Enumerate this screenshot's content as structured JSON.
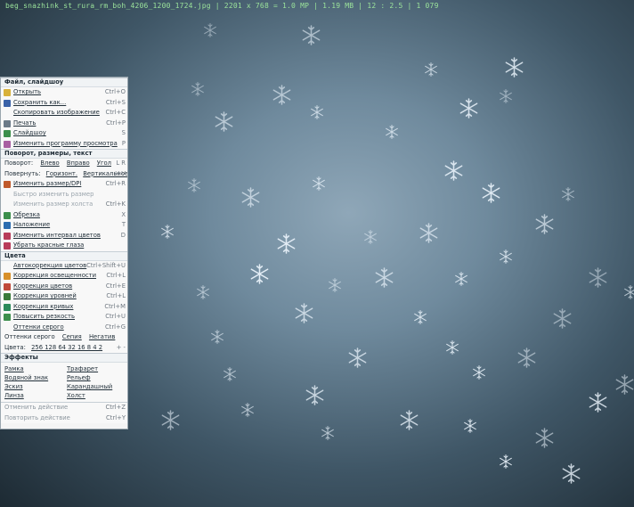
{
  "status": {
    "text": "beg_snazhink_st_rura_rm_boh_4206_1200_1724.jpg  |  2201 x 768 = 1.0 MP  |  1.19 MB  |  12 : 2.5  |  1 079"
  },
  "colors": {
    "panel_bg": "#f4f4f4",
    "accent": "#2b6cb0",
    "bg_center": "#8fa7b8",
    "bg_edge": "#1d2a33"
  },
  "menu": {
    "file": {
      "title": "Файл, слайдшоу",
      "items": [
        {
          "label": "Открыть",
          "shortcut": "Ctrl+O",
          "icon": "open-folder-icon",
          "icon_color": "#d8b13a"
        },
        {
          "label": "Сохранить как...",
          "shortcut": "Ctrl+S",
          "icon": "save-icon",
          "icon_color": "#3a62a8"
        },
        {
          "label": "Скопировать изображение",
          "shortcut": "Ctrl+C",
          "icon": "",
          "icon_color": ""
        },
        {
          "label": "Печать",
          "shortcut": "Ctrl+P",
          "icon": "print-icon",
          "icon_color": "#6b7a88"
        },
        {
          "label": "Слайдшоу",
          "shortcut": "S",
          "icon": "slideshow-icon",
          "icon_color": "#3c8f4c"
        },
        {
          "label": "Изменить программу просмотра",
          "shortcut": "P",
          "icon": "edit-program-icon",
          "icon_color": "#a85fa2"
        }
      ]
    },
    "rotate": {
      "title": "Поворот, размеры, текст",
      "rotate_line": {
        "label": "Поворот:",
        "left": "Влево",
        "right": "Вправо",
        "angle": "Угол",
        "shortcut": "L R"
      },
      "mirror_line": {
        "label": "Повернуть:",
        "horizontal": "Горизонт.",
        "vertical": "Вертикальное",
        "shortcut": "H V"
      },
      "items": [
        {
          "label": "Изменить размер/DPI",
          "shortcut": "Ctrl+R",
          "icon": "resize-icon",
          "icon_color": "#c05a2b",
          "disabled": false
        },
        {
          "label": "Быстро изменить размер",
          "shortcut": "",
          "icon": "",
          "icon_color": "",
          "disabled": true
        },
        {
          "label": "Изменить размер холста",
          "shortcut": "Ctrl+K",
          "icon": "",
          "icon_color": "",
          "disabled": true
        },
        {
          "label": "Обрезка",
          "shortcut": "X",
          "icon": "crop-icon",
          "icon_color": "#3c8f4c",
          "disabled": false
        },
        {
          "label": "Наложение",
          "shortcut": "T",
          "icon": "overlay-icon",
          "icon_color": "#2b6cb0",
          "disabled": false
        },
        {
          "label": "Изменить интервал цветов",
          "shortcut": "D",
          "icon": "color-icon",
          "icon_color": "#b83c5a",
          "disabled": false
        },
        {
          "label": "Убрать красные глаза",
          "shortcut": "",
          "icon": "eye-icon",
          "icon_color": "#b83c5a",
          "disabled": false
        }
      ]
    },
    "colors": {
      "title": "Цвета",
      "items": [
        {
          "label": "Автокоррекция цветов",
          "shortcut": "Ctrl+Shift+U",
          "icon": "",
          "icon_color": ""
        },
        {
          "label": "Коррекция освещенности",
          "shortcut": "Ctrl+L",
          "icon": "light-icon",
          "icon_color": "#d8902a"
        },
        {
          "label": "Коррекция цветов",
          "shortcut": "Ctrl+E",
          "icon": "palette-icon",
          "icon_color": "#c04a3a"
        },
        {
          "label": "Коррекция уровней",
          "shortcut": "Ctrl+L",
          "icon": "levels-icon",
          "icon_color": "#3a7a3a"
        },
        {
          "label": "Коррекция кривых",
          "shortcut": "Ctrl+M",
          "icon": "curves-icon",
          "icon_color": "#2b8a5a"
        },
        {
          "label": "Повысить резкость",
          "shortcut": "Ctrl+U",
          "icon": "sharpen-icon",
          "icon_color": "#3c8f4c"
        },
        {
          "label": "Оттенки серого",
          "shortcut": "Ctrl+G",
          "icon": "",
          "icon_color": ""
        }
      ],
      "neg_line": {
        "label": "Оттенки серого",
        "a": "Сепия",
        "b": "Негатив"
      },
      "bits_line": {
        "label": "Цвета:",
        "values": "256 128 64 32 16 8 4 2",
        "tail": "+ -"
      }
    },
    "effects": {
      "title": "Эффекты",
      "left": [
        "Рамка",
        "Водяной знак",
        "Эскиз",
        "Линза"
      ],
      "right": [
        "Трафарет",
        "Рельеф",
        "Карандашный",
        "Холст"
      ]
    },
    "bottom": [
      {
        "label": "Отменить действие",
        "shortcut": "Ctrl+Z"
      },
      {
        "label": "Повторить действие",
        "shortcut": "Ctrl+Y"
      }
    ]
  }
}
